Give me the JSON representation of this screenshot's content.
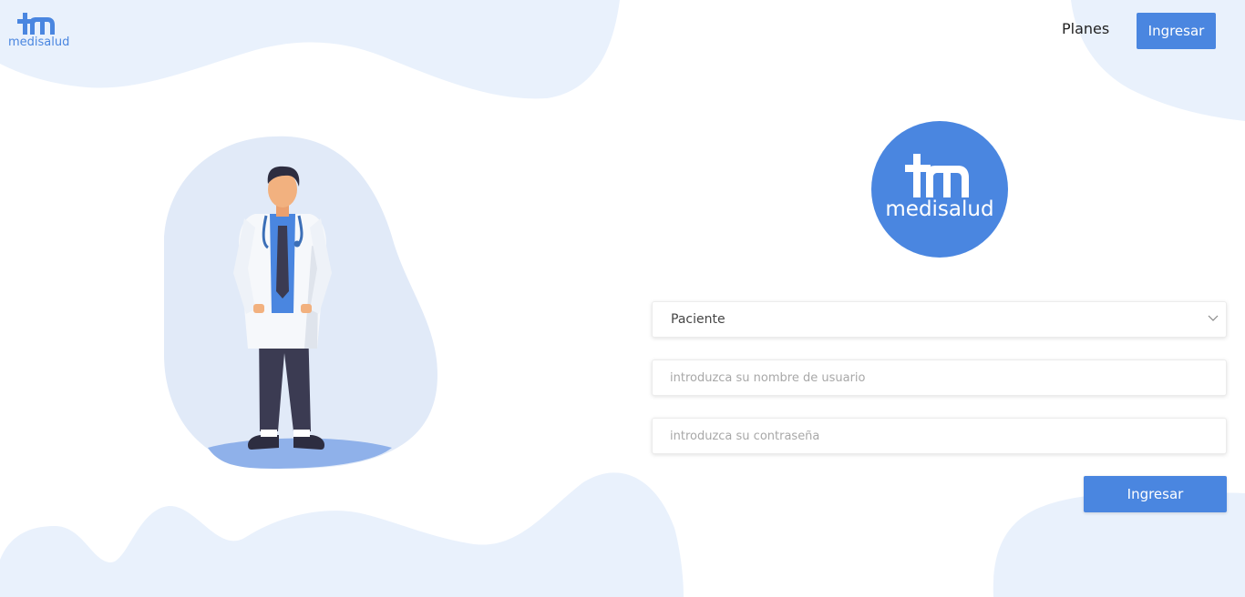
{
  "brand": {
    "name": "medisalud",
    "color": "#4a86e0",
    "background_blob_color": "#e9f1fc"
  },
  "nav": {
    "planes_label": "Planes",
    "login_label": "Ingresar"
  },
  "illustration": {
    "icon": "doctor-illustration"
  },
  "form": {
    "role_select": {
      "selected": "Paciente",
      "icon": "chevron-down-icon"
    },
    "username": {
      "value": "",
      "placeholder": "introduzca su nombre de usuario"
    },
    "password": {
      "value": "",
      "placeholder": "introduzca su contraseña"
    },
    "submit_label": "Ingresar"
  }
}
